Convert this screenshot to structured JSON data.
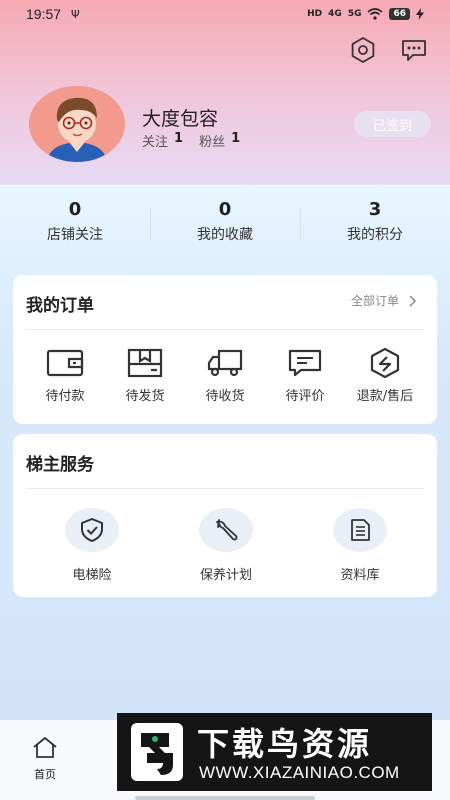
{
  "status_bar": {
    "time": "19:57",
    "usb": "Ψ",
    "hd": "HD",
    "net1": "4G",
    "net2": "5G",
    "battery": "66"
  },
  "header": {
    "settings_icon": "hexagon-settings-icon",
    "message_icon": "message-icon"
  },
  "profile": {
    "name": "大度包容",
    "follow_label": "关注",
    "follow_count": "1",
    "fans_label": "粉丝",
    "fans_count": "1",
    "checkin_label": "已签到"
  },
  "stats": [
    {
      "value": "0",
      "label": "店铺关注"
    },
    {
      "value": "0",
      "label": "我的收藏"
    },
    {
      "value": "3",
      "label": "我的积分"
    }
  ],
  "orders": {
    "title": "我的订单",
    "all_label": "全部订单",
    "items": [
      {
        "label": "待付款",
        "icon": "wallet-icon"
      },
      {
        "label": "待发货",
        "icon": "box-icon"
      },
      {
        "label": "待收货",
        "icon": "truck-icon"
      },
      {
        "label": "待评价",
        "icon": "comment-icon"
      },
      {
        "label": "退款/售后",
        "icon": "refund-icon"
      }
    ]
  },
  "services": {
    "title": "梯主服务",
    "items": [
      {
        "label": "电梯险",
        "icon": "shield-icon"
      },
      {
        "label": "保养计划",
        "icon": "wrench-icon"
      },
      {
        "label": "资料库",
        "icon": "document-icon"
      }
    ]
  },
  "nav": {
    "home_label": "首页"
  },
  "watermark": {
    "title": "下载鸟资源",
    "url": "WWW.XIAZAINIAO.COM"
  },
  "colors": {
    "header_top": "#f6a9b3",
    "header_bottom": "#e6dcf7",
    "page_bg": "#d6e6fa",
    "card_bg": "#ffffff",
    "checkin_bg": "#e8dff0"
  }
}
